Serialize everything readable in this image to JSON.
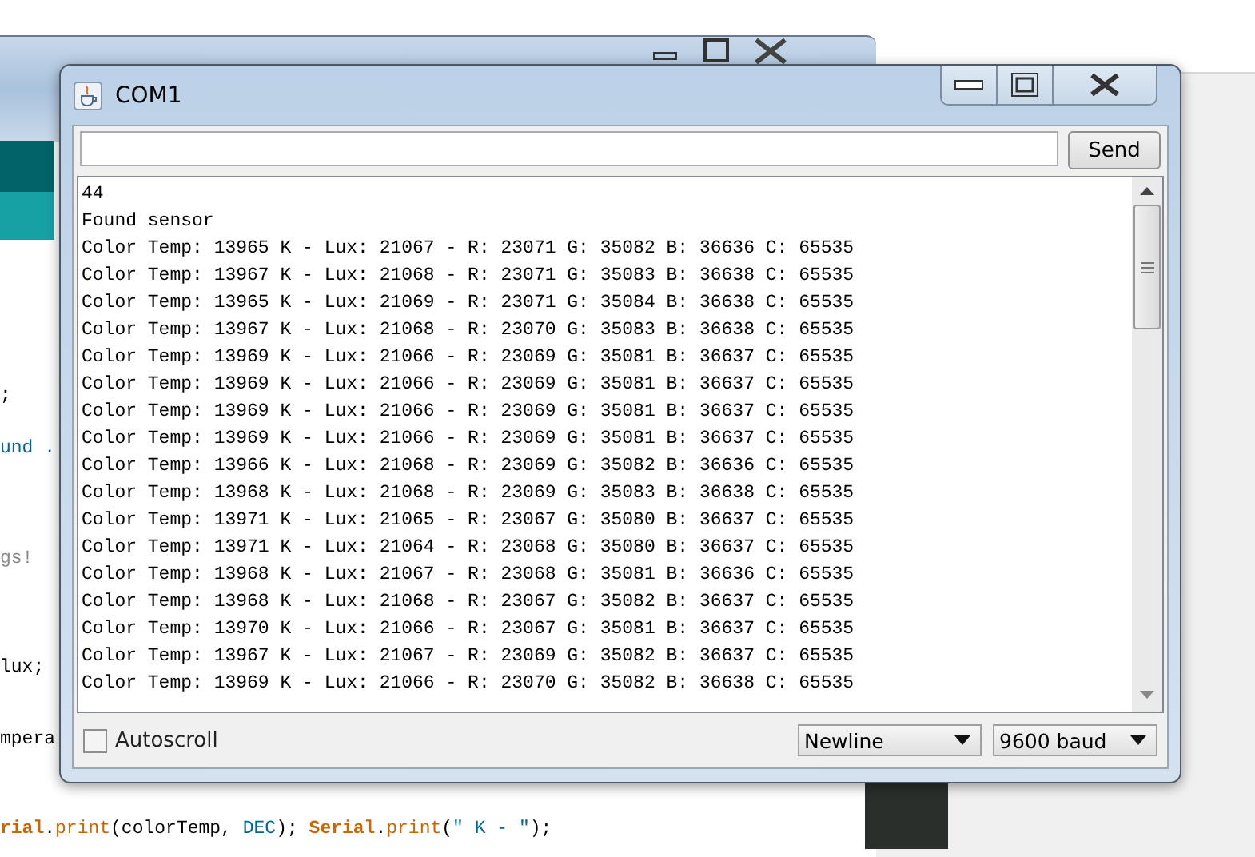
{
  "background_editor": {
    "code_lines": [
      {
        "kind": "plain",
        "text": ";"
      },
      {
        "kind": "string",
        "text": "und ."
      },
      {
        "kind": "comment",
        "text": "gs!"
      },
      {
        "kind": "plain",
        "text": "lux;"
      },
      {
        "kind": "plain",
        "text": "mpera"
      },
      {
        "kind": "tokens",
        "tokens": [
          {
            "kind": "keyword",
            "text": "rial"
          },
          {
            "kind": "plain",
            "text": "."
          },
          {
            "kind": "function",
            "text": "print"
          },
          {
            "kind": "plain",
            "text": "(colorTemp, "
          },
          {
            "kind": "constant",
            "text": "DEC"
          },
          {
            "kind": "plain",
            "text": "); "
          },
          {
            "kind": "keyword",
            "text": "Serial"
          },
          {
            "kind": "plain",
            "text": "."
          },
          {
            "kind": "function",
            "text": "print"
          },
          {
            "kind": "plain",
            "text": "("
          },
          {
            "kind": "constant",
            "text": "\" K - \""
          },
          {
            "kind": "plain",
            "text": ");"
          }
        ]
      }
    ]
  },
  "serial_monitor": {
    "title": "COM1",
    "send_button": "Send",
    "output_lines": [
      "44",
      "Found sensor",
      "Color Temp: 13965 K - Lux: 21067 - R: 23071 G: 35082 B: 36636 C: 65535",
      "Color Temp: 13967 K - Lux: 21068 - R: 23071 G: 35083 B: 36638 C: 65535",
      "Color Temp: 13965 K - Lux: 21069 - R: 23071 G: 35084 B: 36638 C: 65535",
      "Color Temp: 13967 K - Lux: 21068 - R: 23070 G: 35083 B: 36638 C: 65535",
      "Color Temp: 13969 K - Lux: 21066 - R: 23069 G: 35081 B: 36637 C: 65535",
      "Color Temp: 13969 K - Lux: 21066 - R: 23069 G: 35081 B: 36637 C: 65535",
      "Color Temp: 13969 K - Lux: 21066 - R: 23069 G: 35081 B: 36637 C: 65535",
      "Color Temp: 13969 K - Lux: 21066 - R: 23069 G: 35081 B: 36637 C: 65535",
      "Color Temp: 13966 K - Lux: 21068 - R: 23069 G: 35082 B: 36636 C: 65535",
      "Color Temp: 13968 K - Lux: 21068 - R: 23069 G: 35083 B: 36638 C: 65535",
      "Color Temp: 13971 K - Lux: 21065 - R: 23067 G: 35080 B: 36637 C: 65535",
      "Color Temp: 13971 K - Lux: 21064 - R: 23068 G: 35080 B: 36637 C: 65535",
      "Color Temp: 13968 K - Lux: 21067 - R: 23068 G: 35081 B: 36636 C: 65535",
      "Color Temp: 13968 K - Lux: 21068 - R: 23067 G: 35082 B: 36637 C: 65535",
      "Color Temp: 13970 K - Lux: 21066 - R: 23067 G: 35081 B: 36637 C: 65535",
      "Color Temp: 13967 K - Lux: 21067 - R: 23069 G: 35082 B: 36637 C: 65535",
      "Color Temp: 13969 K - Lux: 21066 - R: 23070 G: 35082 B: 36638 C: 65535"
    ],
    "autoscroll": {
      "label": "Autoscroll",
      "checked": false
    },
    "line_ending": "Newline",
    "baud_rate": "9600 baud"
  }
}
